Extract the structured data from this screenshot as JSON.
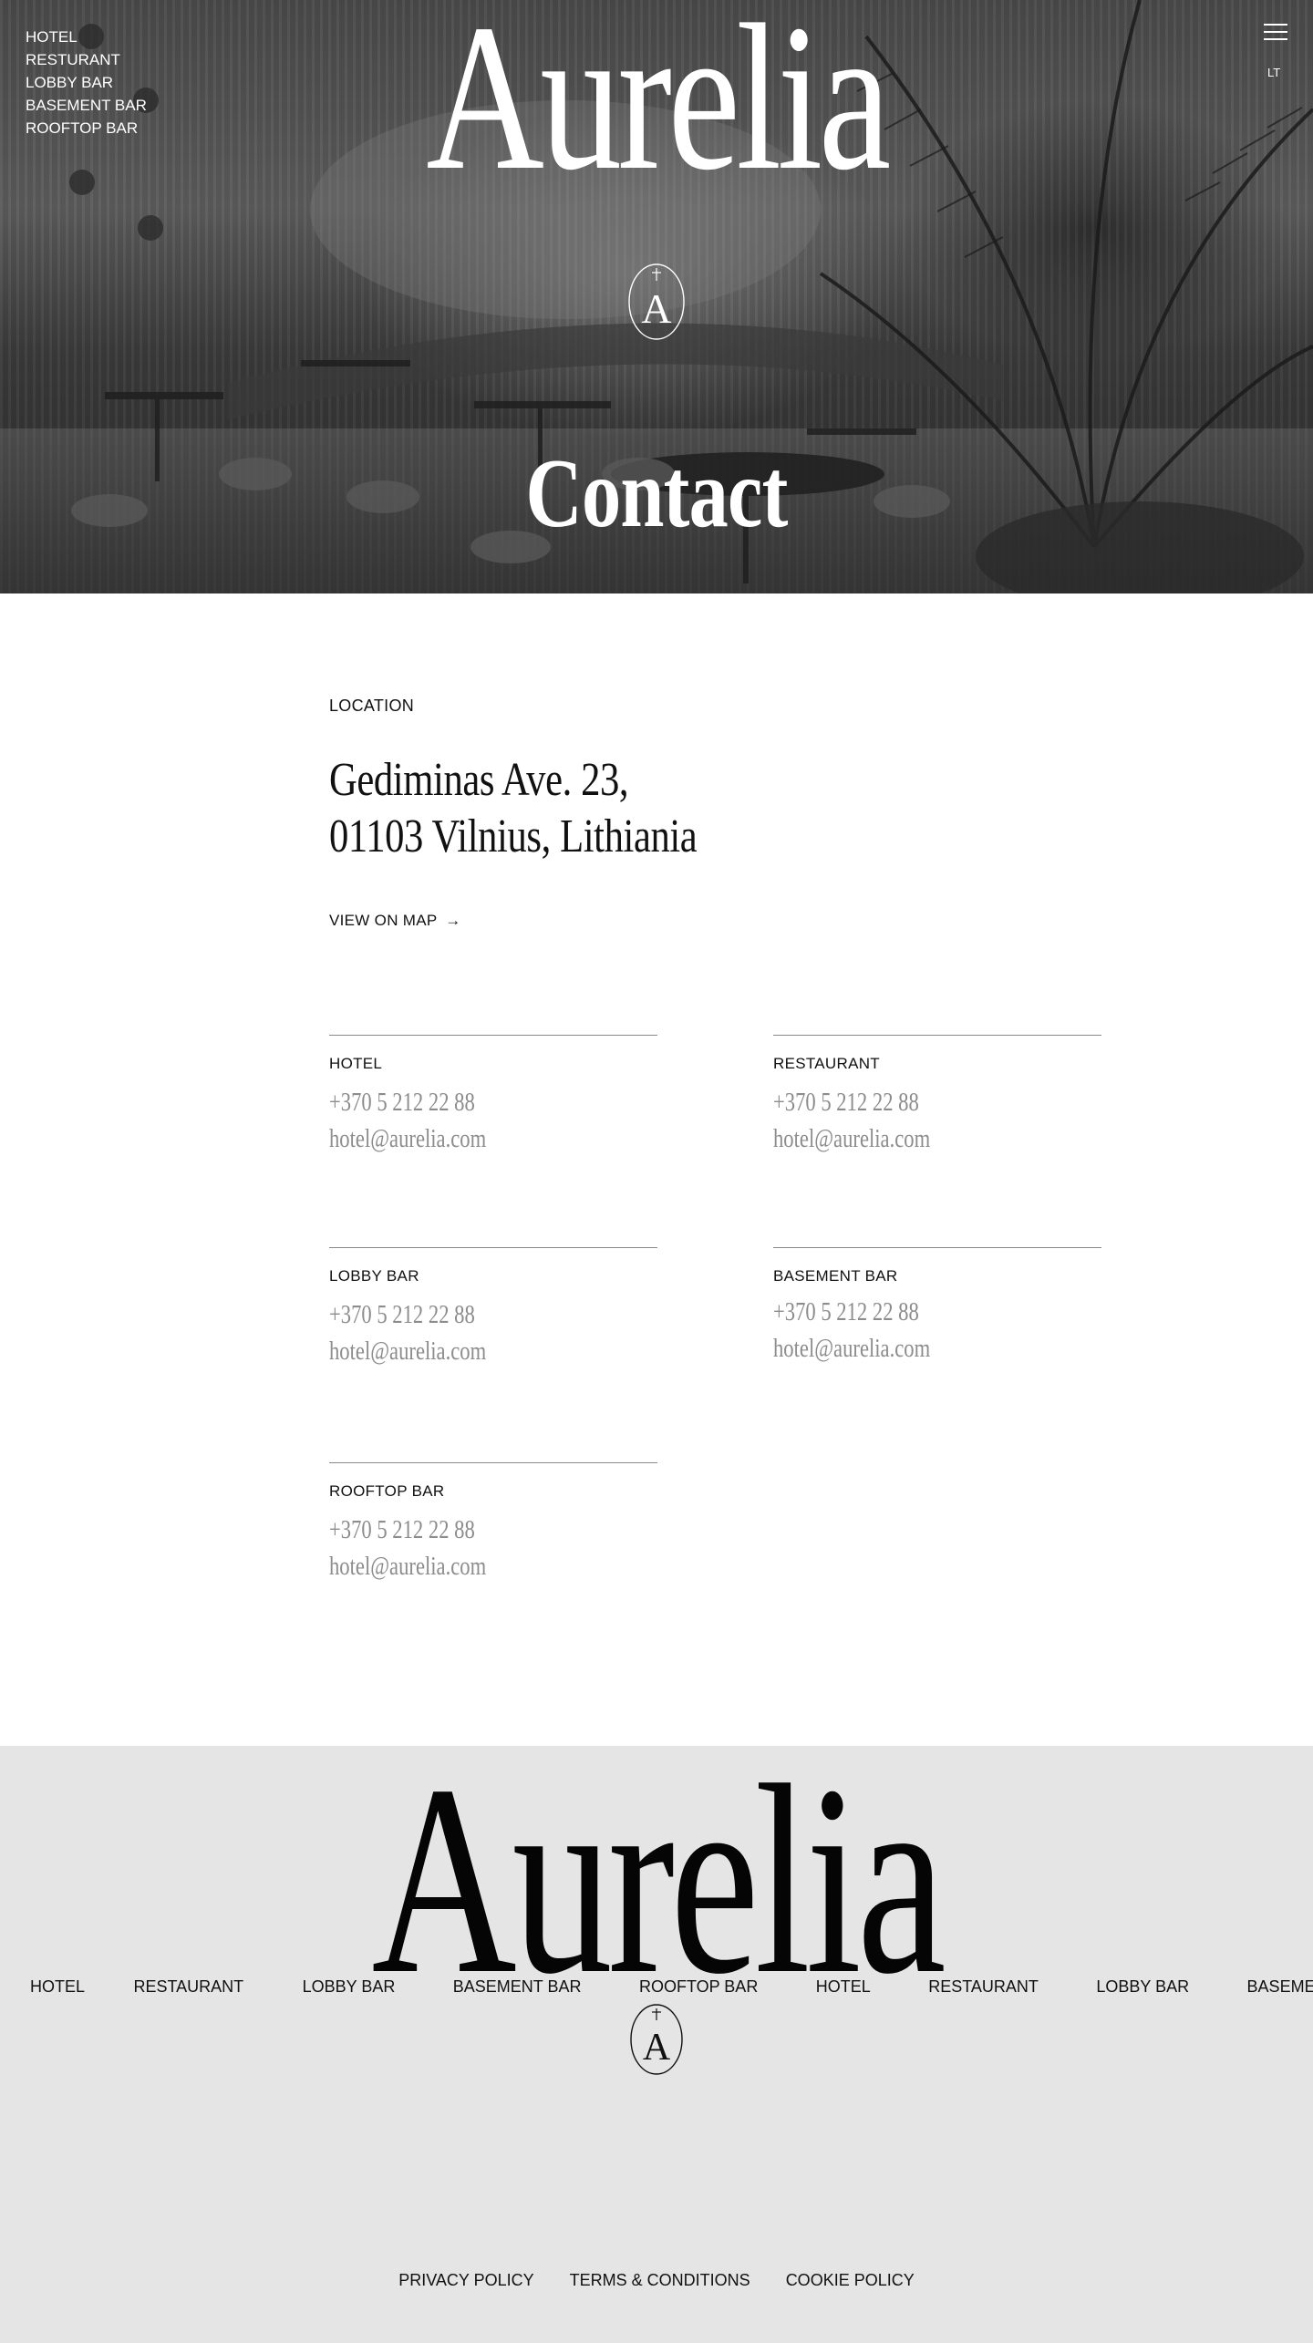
{
  "brand": {
    "wordmark": "Aurelia",
    "monogram": "A"
  },
  "hero": {
    "nav": [
      "HOTEL",
      "RESTURANT",
      "LOBBY BAR",
      "BASEMENT BAR",
      "ROOFTOP BAR"
    ],
    "title": "Contact",
    "lang": "LT",
    "menu_icon": "hamburger-icon"
  },
  "location": {
    "label": "LOCATION",
    "address_line1": "Gediminas Ave. 23,",
    "address_line2": "01103 Vilnius, Lithiania",
    "map_link": "VIEW ON MAP",
    "map_arrow": "→"
  },
  "contacts": [
    {
      "name": "HOTEL",
      "phone": "+370 5 212 22 88",
      "email": "hotel@aurelia.com"
    },
    {
      "name": "RESTAURANT",
      "phone": "+370 5 212 22 88",
      "email": "hotel@aurelia.com"
    },
    {
      "name": "LOBBY BAR",
      "phone": "+370 5 212 22 88",
      "email": "hotel@aurelia.com"
    },
    {
      "name": "BASEMENT BAR",
      "phone": "+370 5 212 22 88",
      "email": "hotel@aurelia.com"
    },
    {
      "name": "ROOFTOP BAR",
      "phone": "+370 5 212 22 88",
      "email": "hotel@aurelia.com"
    }
  ],
  "footer": {
    "marquee": [
      "HOTEL",
      "RESTAURANT",
      "LOBBY BAR",
      "BASEMENT BAR",
      "ROOFTOP BAR",
      "HOTEL",
      "RESTAURANT",
      "LOBBY BAR",
      "BASEMENT BAR"
    ],
    "legal": [
      "PRIVACY POLICY",
      "TERMS & CONDITIONS",
      "COOKIE POLICY"
    ]
  }
}
